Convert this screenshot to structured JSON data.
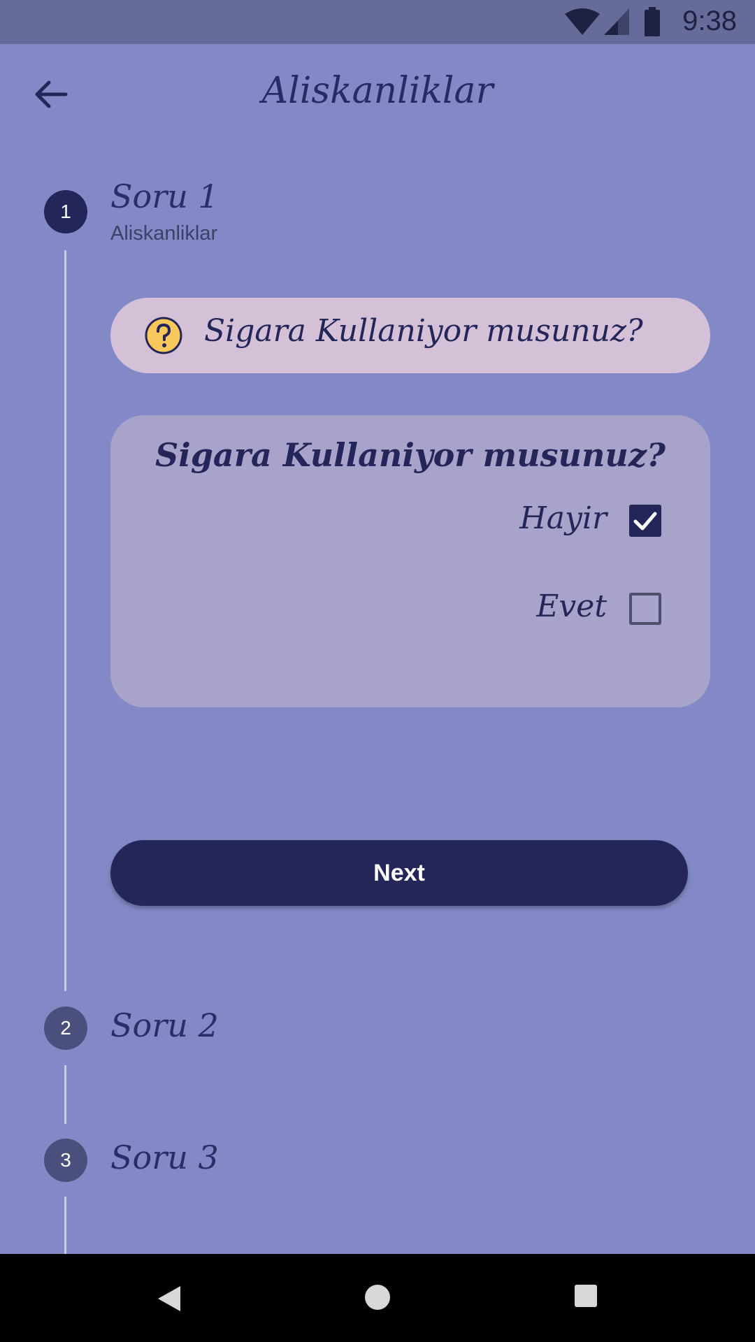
{
  "status_bar": {
    "time": "9:38"
  },
  "header": {
    "title": "Aliskanliklar"
  },
  "steps": [
    {
      "number": "1",
      "title": "Soru 1",
      "subtitle": "Aliskanliklar"
    },
    {
      "number": "2",
      "title": "Soru 2"
    },
    {
      "number": "3",
      "title": "Soru 3"
    }
  ],
  "question": {
    "banner_text": "Sigara Kullaniyor musunuz?",
    "card_title": "Sigara Kullaniyor musunuz?",
    "options": [
      {
        "label": "Hayir",
        "checked": true
      },
      {
        "label": "Evet",
        "checked": false
      }
    ]
  },
  "actions": {
    "next_label": "Next"
  },
  "colors": {
    "background": "#8389c6",
    "accent": "#242659",
    "banner": "#d4c1d8",
    "card": "#a8a3cb"
  },
  "icons": [
    "wifi-icon",
    "signal-icon",
    "battery-icon",
    "back-arrow-icon",
    "question-icon",
    "check-icon",
    "nav-back-icon",
    "nav-home-icon",
    "nav-recents-icon"
  ]
}
